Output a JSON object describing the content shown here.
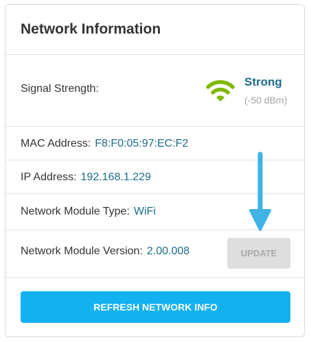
{
  "panel": {
    "title": "Network Information"
  },
  "signal": {
    "label": "Signal Strength:",
    "strength": "Strong",
    "dbm": "(-50 dBm)",
    "icon": "wifi-icon",
    "color": "#7fb800"
  },
  "mac": {
    "label": "MAC Address:",
    "value": "F8:F0:05:97:EC:F2"
  },
  "ip": {
    "label": "IP Address:",
    "value": "192.168.1.229"
  },
  "module_type": {
    "label": "Network Module Type:",
    "value": "WiFi"
  },
  "module_version": {
    "label": "Network Module Version:",
    "value": "2.00.008",
    "update_label": "UPDATE"
  },
  "refresh": {
    "label": "REFRESH NETWORK INFO"
  },
  "colors": {
    "accent": "#13b1f0",
    "value_text": "#1a6b8a",
    "annotation_arrow": "#3fb3e6"
  }
}
